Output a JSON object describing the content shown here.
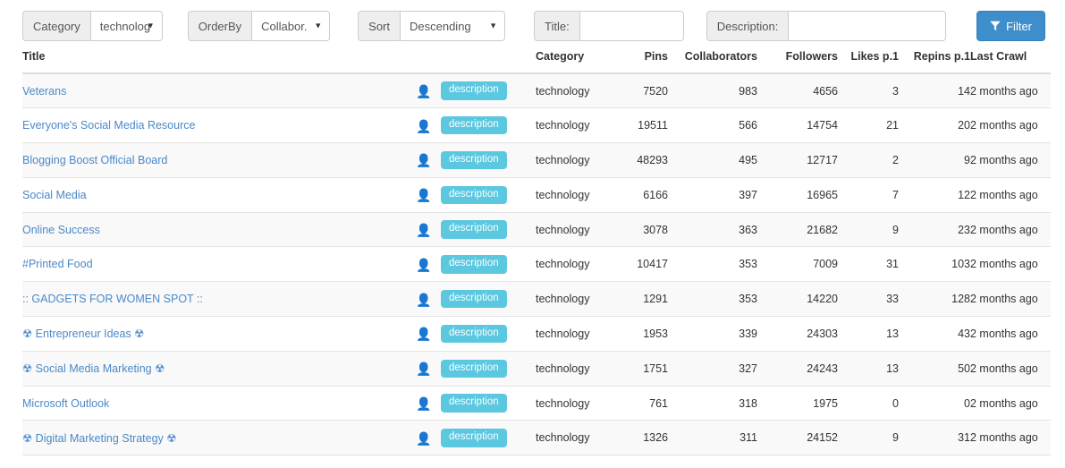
{
  "toolbar": {
    "category": {
      "label": "Category",
      "value": "technolog",
      "icon": "chevron-down-icon"
    },
    "orderby": {
      "label": "OrderBy",
      "value": "Collabor.",
      "icon": "chevron-down-icon"
    },
    "sort": {
      "label": "Sort",
      "value": "Descending",
      "icon": "chevron-down-icon"
    },
    "title": {
      "label": "Title:",
      "value": "",
      "placeholder": ""
    },
    "description": {
      "label": "Description:",
      "value": "",
      "placeholder": ""
    },
    "filter_button": {
      "label": "Filter",
      "icon": "filter-icon",
      "color": "#3e8ecc"
    }
  },
  "table": {
    "columns": [
      "Title",
      "Category",
      "Pins",
      "Collaborators",
      "Followers",
      "Likes p.1",
      "Repins p.1",
      "Last Crawl"
    ],
    "badge_label": "description",
    "user_icon": "user-icon",
    "rows": [
      {
        "title": "Veterans",
        "category": "technology",
        "pins": "7520",
        "collaborators": "983",
        "followers": "4656",
        "likes": "3",
        "repins": "14",
        "last_crawl": "2 months ago"
      },
      {
        "title": "Everyone's Social Media Resource",
        "category": "technology",
        "pins": "19511",
        "collaborators": "566",
        "followers": "14754",
        "likes": "21",
        "repins": "20",
        "last_crawl": "2 months ago"
      },
      {
        "title": "Blogging Boost Official Board",
        "category": "technology",
        "pins": "48293",
        "collaborators": "495",
        "followers": "12717",
        "likes": "2",
        "repins": "9",
        "last_crawl": "2 months ago"
      },
      {
        "title": "Social Media",
        "category": "technology",
        "pins": "6166",
        "collaborators": "397",
        "followers": "16965",
        "likes": "7",
        "repins": "12",
        "last_crawl": "2 months ago"
      },
      {
        "title": "Online Success",
        "category": "technology",
        "pins": "3078",
        "collaborators": "363",
        "followers": "21682",
        "likes": "9",
        "repins": "23",
        "last_crawl": "2 months ago"
      },
      {
        "title": "#Printed Food",
        "category": "technology",
        "pins": "10417",
        "collaborators": "353",
        "followers": "7009",
        "likes": "31",
        "repins": "103",
        "last_crawl": "2 months ago"
      },
      {
        "title": ":: GADGETS FOR WOMEN SPOT ::",
        "category": "technology",
        "pins": "1291",
        "collaborators": "353",
        "followers": "14220",
        "likes": "33",
        "repins": "128",
        "last_crawl": "2 months ago"
      },
      {
        "title": "☢ Entrepreneur Ideas ☢",
        "category": "technology",
        "pins": "1953",
        "collaborators": "339",
        "followers": "24303",
        "likes": "13",
        "repins": "43",
        "last_crawl": "2 months ago"
      },
      {
        "title": "☢ Social Media Marketing ☢",
        "category": "technology",
        "pins": "1751",
        "collaborators": "327",
        "followers": "24243",
        "likes": "13",
        "repins": "50",
        "last_crawl": "2 months ago"
      },
      {
        "title": "Microsoft Outlook",
        "category": "technology",
        "pins": "761",
        "collaborators": "318",
        "followers": "1975",
        "likes": "0",
        "repins": "0",
        "last_crawl": "2 months ago"
      },
      {
        "title": "☢ Digital Marketing Strategy ☢",
        "category": "technology",
        "pins": "1326",
        "collaborators": "311",
        "followers": "24152",
        "likes": "9",
        "repins": "31",
        "last_crawl": "2 months ago"
      }
    ]
  },
  "colors": {
    "link": "#4a89c8",
    "badge": "#5bc8e0",
    "primary": "#3e8ecc",
    "stripe": "#f9f9f9"
  }
}
